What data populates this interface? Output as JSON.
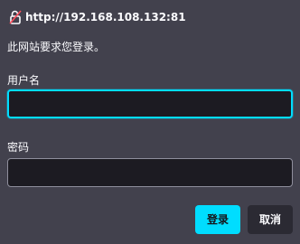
{
  "dialog": {
    "origin": "http://192.168.108.132:81",
    "message": "此网站要求您登录。",
    "username_label": "用户名",
    "username_value": "",
    "password_label": "密码",
    "password_value": "",
    "login_label": "登录",
    "cancel_label": "取消"
  },
  "icons": {
    "origin_icon": "unlocked-padlock-icon"
  },
  "colors": {
    "background": "#42414d",
    "input_background": "#1c1b22",
    "focus_accent": "#00ddff",
    "primary_button": "#00ddff",
    "secondary_button": "#2b2a33",
    "insecure_icon": "#ff4f5e"
  }
}
